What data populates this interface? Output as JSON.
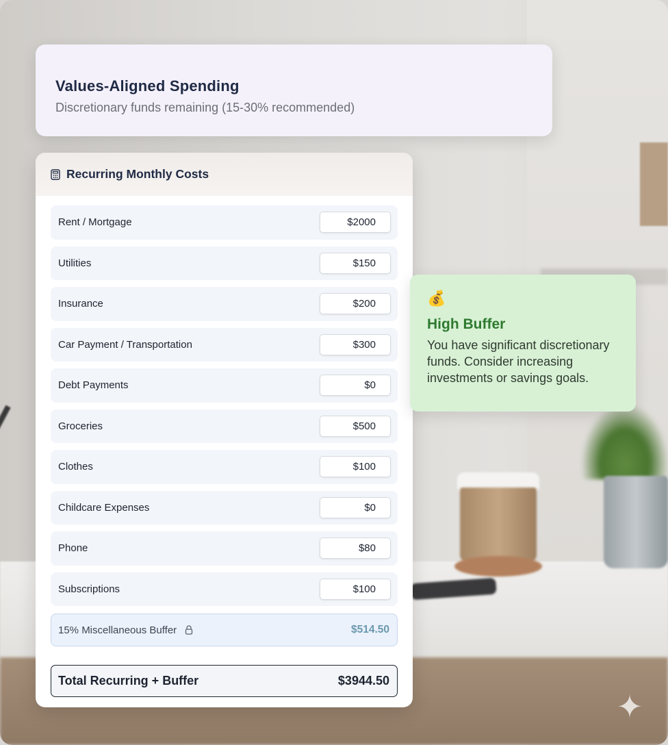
{
  "header": {
    "title": "Values-Aligned Spending",
    "subtitle": "Discretionary funds remaining (15-30% recommended)"
  },
  "costs_panel": {
    "title": "Recurring Monthly Costs",
    "icon": "calculator-icon",
    "items": [
      {
        "label": "Rent / Mortgage",
        "value": "$2000"
      },
      {
        "label": "Utilities",
        "value": "$150"
      },
      {
        "label": "Insurance",
        "value": "$200"
      },
      {
        "label": "Car Payment / Transportation",
        "value": "$300"
      },
      {
        "label": "Debt Payments",
        "value": "$0"
      },
      {
        "label": "Groceries",
        "value": "$500"
      },
      {
        "label": "Clothes",
        "value": "$100"
      },
      {
        "label": "Childcare Expenses",
        "value": "$0"
      },
      {
        "label": "Phone",
        "value": "$80"
      },
      {
        "label": "Subscriptions",
        "value": "$100"
      }
    ],
    "buffer": {
      "label": "15% Miscellaneous Buffer",
      "value": "$514.50",
      "icon": "lock-icon"
    },
    "total": {
      "label": "Total Recurring + Buffer",
      "value": "$3944.50"
    }
  },
  "status": {
    "icon": "money-bag-icon",
    "icon_glyph": "💰",
    "title": "High Buffer",
    "message": "You have significant discretionary funds. Consider increasing investments or savings goals."
  },
  "colors": {
    "accent_green": "#2e7a2f",
    "status_bg": "#d8f1d5",
    "header_bg": "#f5f1fb",
    "buffer_value": "#6b98ae"
  }
}
